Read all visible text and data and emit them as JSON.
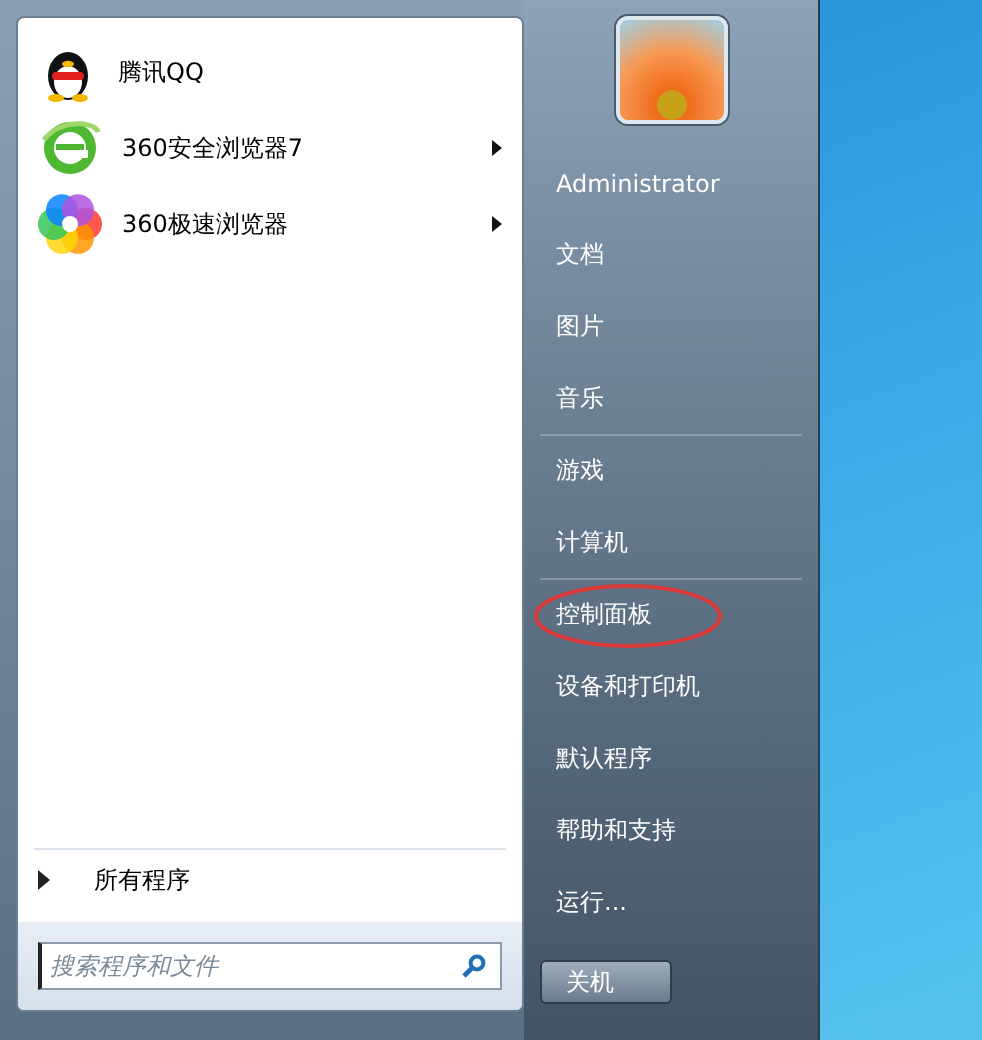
{
  "programs": [
    {
      "label": "腾讯QQ",
      "has_submenu": false
    },
    {
      "label": "360安全浏览器7",
      "has_submenu": true
    },
    {
      "label": "360极速浏览器",
      "has_submenu": true
    }
  ],
  "all_programs": {
    "label": "所有程序"
  },
  "search": {
    "placeholder": "搜索程序和文件"
  },
  "user": {
    "name": "Administrator"
  },
  "places": [
    {
      "label": "文档",
      "separator_after": false,
      "highlighted": false
    },
    {
      "label": "图片",
      "separator_after": false,
      "highlighted": false
    },
    {
      "label": "音乐",
      "separator_after": true,
      "highlighted": false
    },
    {
      "label": "游戏",
      "separator_after": false,
      "highlighted": false
    },
    {
      "label": "计算机",
      "separator_after": true,
      "highlighted": false
    },
    {
      "label": "控制面板",
      "separator_after": false,
      "highlighted": true
    },
    {
      "label": "设备和打印机",
      "separator_after": false,
      "highlighted": false
    },
    {
      "label": "默认程序",
      "separator_after": false,
      "highlighted": false
    },
    {
      "label": "帮助和支持",
      "separator_after": false,
      "highlighted": false
    },
    {
      "label": "运行...",
      "separator_after": false,
      "highlighted": false
    }
  ],
  "shutdown": {
    "label": "关机"
  }
}
